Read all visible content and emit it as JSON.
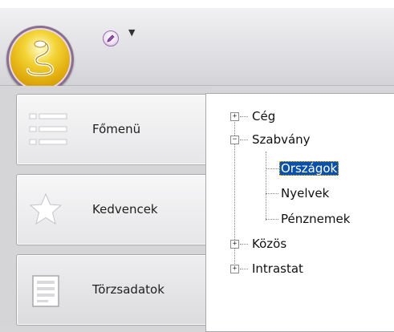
{
  "nav": {
    "items": [
      {
        "label": "Főmenü",
        "icon": "list-icon"
      },
      {
        "label": "Kedvencek",
        "icon": "star-icon"
      },
      {
        "label": "Törzsadatok",
        "icon": "form-icon",
        "active": true
      }
    ]
  },
  "quick_access": {
    "dropdown_glyph": "▼"
  },
  "tree": {
    "nodes": [
      {
        "label": "Cég",
        "expanded": false
      },
      {
        "label": "Szabvány",
        "expanded": true,
        "children": [
          {
            "label": "Országok",
            "selected": true
          },
          {
            "label": "Nyelvek"
          },
          {
            "label": "Pénznemek"
          }
        ]
      },
      {
        "label": "Közös",
        "expanded": false
      },
      {
        "label": "Intrastat",
        "expanded": false
      }
    ]
  },
  "colors": {
    "selection": "#0a4fa8",
    "ribbon": "#e1e1e5",
    "orb": "#e8b71a"
  }
}
